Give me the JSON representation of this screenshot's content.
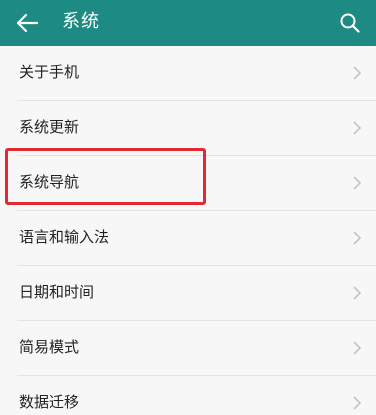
{
  "header": {
    "title": "系统",
    "back_icon": "arrow-left-icon",
    "search_icon": "search-icon",
    "background_color": "#1d8b83"
  },
  "settings": {
    "items": [
      {
        "label": "关于手机"
      },
      {
        "label": "系统更新"
      },
      {
        "label": "系统导航"
      },
      {
        "label": "语言和输入法"
      },
      {
        "label": "日期和时间"
      },
      {
        "label": "简易模式"
      },
      {
        "label": "数据迁移"
      }
    ],
    "highlighted_item": "系统导航",
    "highlight_color": "#e02a2f"
  }
}
